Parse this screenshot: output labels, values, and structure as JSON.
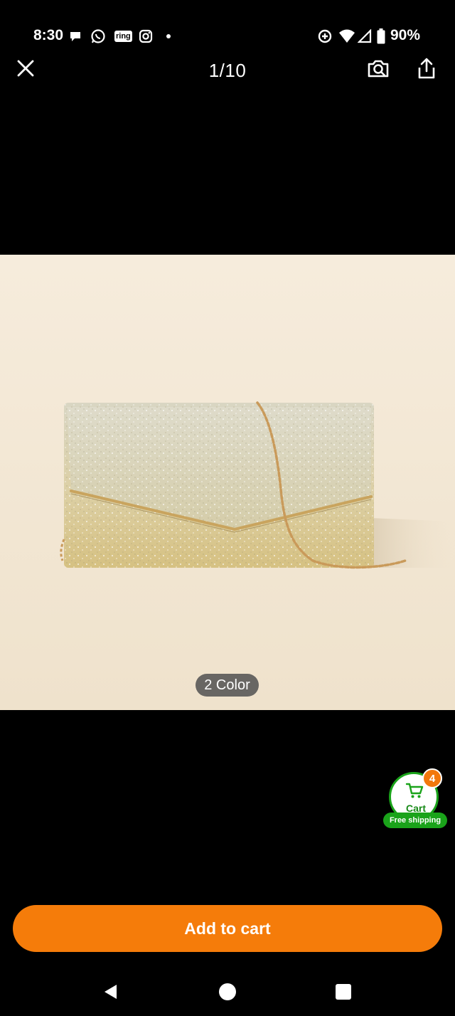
{
  "status_bar": {
    "time": "8:30",
    "ring_label": "ring",
    "battery": "90%"
  },
  "header": {
    "image_counter": "1/10"
  },
  "product": {
    "color_label": "2 Color"
  },
  "cart": {
    "label": "Cart",
    "count": "4",
    "free_shipping": "Free shipping"
  },
  "actions": {
    "add_to_cart": "Add to cart"
  },
  "colors": {
    "accent": "#f57c0a",
    "cart_green": "#1aa31a"
  }
}
